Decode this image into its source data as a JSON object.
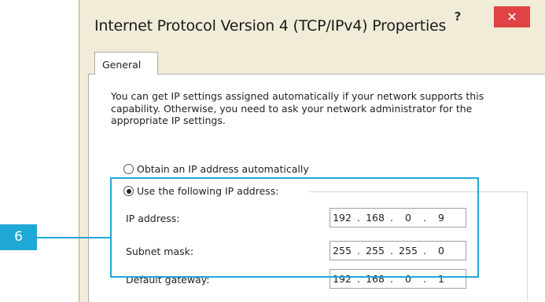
{
  "window": {
    "title": "Internet Protocol Version 4 (TCP/IPv4) Properties",
    "help_label": "?",
    "close_label": "✕"
  },
  "tabs": [
    {
      "label": "General",
      "selected": true
    }
  ],
  "description": "You can get IP settings assigned automatically if your network supports this capability. Otherwise, you need to ask your network administrator for the appropriate IP settings.",
  "ip_mode": {
    "auto_label": "Obtain an IP address automatically",
    "manual_label": "Use the following IP address:",
    "selected": "manual"
  },
  "fields": [
    {
      "label": "IP address:",
      "octets": [
        "192",
        "168",
        "0",
        "9"
      ]
    },
    {
      "label": "Subnet mask:",
      "octets": [
        "255",
        "255",
        "255",
        "0"
      ]
    },
    {
      "label": "Default gateway:",
      "octets": [
        "192",
        "168",
        "0",
        "1"
      ]
    }
  ],
  "annotation": {
    "callout_number": "6",
    "color": "#1fa8d6"
  },
  "colors": {
    "close_button": "#e04343",
    "dialog_chrome": "#f0ecd8"
  }
}
